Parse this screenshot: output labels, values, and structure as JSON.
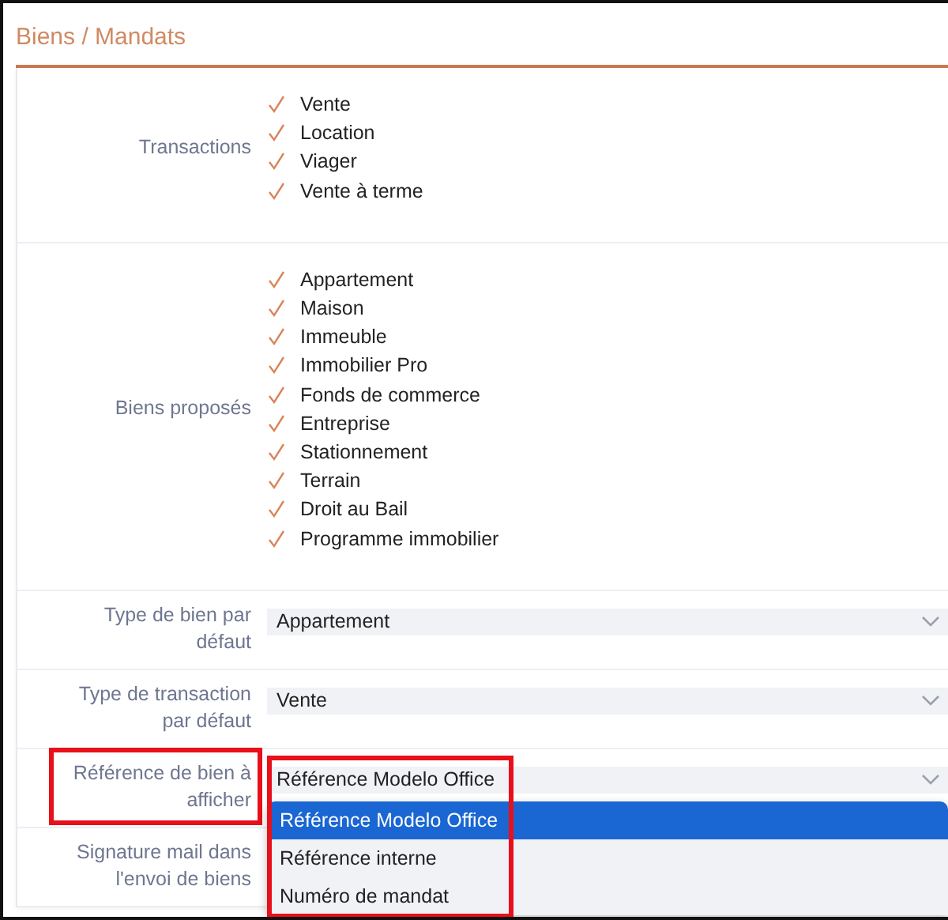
{
  "section": {
    "title": "Biens / Mandats"
  },
  "rows": [
    {
      "kind": "checklist",
      "label": "Transactions",
      "items": [
        {
          "text": "Vente",
          "checked": true
        },
        {
          "text": "Location",
          "checked": true
        },
        {
          "text": "Viager",
          "checked": true
        },
        {
          "text": "Vente à terme",
          "checked": true
        }
      ]
    },
    {
      "kind": "checklist",
      "label": "Biens proposés",
      "items": [
        {
          "text": "Appartement",
          "checked": true
        },
        {
          "text": "Maison",
          "checked": true
        },
        {
          "text": "Immeuble",
          "checked": true
        },
        {
          "text": "Immobilier Pro",
          "checked": true
        },
        {
          "text": "Fonds de commerce",
          "checked": true
        },
        {
          "text": "Entreprise",
          "checked": true
        },
        {
          "text": "Stationnement",
          "checked": true
        },
        {
          "text": "Terrain",
          "checked": true
        },
        {
          "text": "Droit au Bail",
          "checked": true
        },
        {
          "text": "Programme immobilier",
          "checked": true
        }
      ]
    },
    {
      "kind": "select",
      "label": "Type de bien par défaut",
      "value": "Appartement"
    },
    {
      "kind": "select",
      "label": "Type de transaction par défaut",
      "value": "Vente"
    },
    {
      "kind": "select",
      "label": "Référence de bien à afficher",
      "value": "Référence Modelo Office",
      "highlighted": true,
      "expanded": true,
      "options": [
        {
          "text": "Référence Modelo Office",
          "selected": true
        },
        {
          "text": "Référence interne",
          "selected": false
        },
        {
          "text": "Numéro de mandat",
          "selected": false
        }
      ]
    },
    {
      "kind": "empty",
      "label": "Signature mail dans l'envoi de biens"
    }
  ]
}
